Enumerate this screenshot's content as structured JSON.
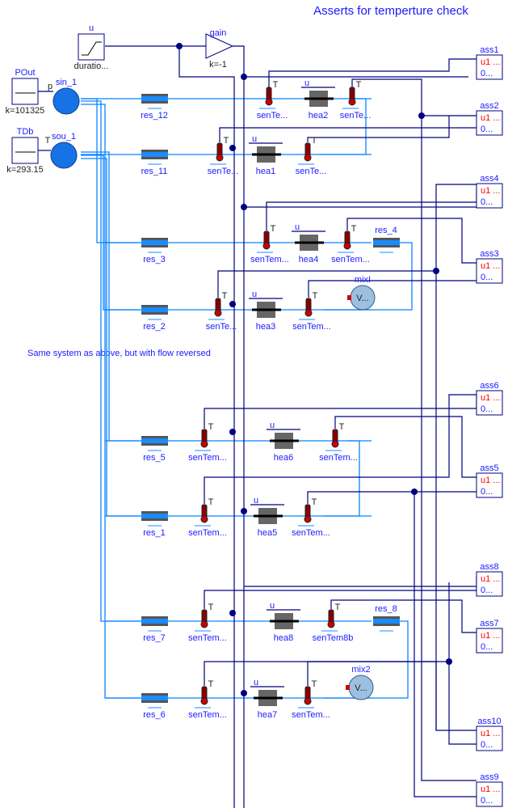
{
  "title": "Asserts for temperture check",
  "note": "Same system as above, but with flow reversed",
  "colors": {
    "fluid": "#0a84ff",
    "signal": "#00007f",
    "label": "#1a1aff",
    "assert_input": "#ff0000"
  },
  "sources": {
    "u": {
      "name": "u",
      "param": "duratio..."
    },
    "gain": {
      "name": "gain",
      "param": "k=-1"
    },
    "POut": {
      "name": "POut",
      "param": "k=101325"
    },
    "TDb": {
      "name": "TDb",
      "param": "k=293.15"
    },
    "sin_1": {
      "name": "sin_1",
      "port": "p"
    },
    "sou_1": {
      "name": "sou_1",
      "port": "T"
    }
  },
  "pipes": {
    "res_12": "res_12",
    "res_11": "res_11",
    "res_3": "res_3",
    "res_2": "res_2",
    "res_5": "res_5",
    "res_1": "res_1",
    "res_7": "res_7",
    "res_6": "res_6",
    "res_4": "res_4",
    "res_8": "res_8"
  },
  "sensors": {
    "s1a": "senTe...",
    "s1b": "senTe...",
    "s2a": "senTe...",
    "s2b": "senTe...",
    "s3a": "senTem...",
    "s3b": "senTem...",
    "s4a": "senTe...",
    "s4b": "senTem...",
    "s5a": "senTem...",
    "s5b": "senTem...",
    "s6a": "senTem...",
    "s6b": "senTem...",
    "s7a": "senTem...",
    "s7b": "senTem8b",
    "s8a": "senTem...",
    "s8b": "senTem...",
    "port_label": "T"
  },
  "heaters": {
    "hea2": "hea2",
    "hea1": "hea1",
    "hea4": "hea4",
    "hea3": "hea3",
    "hea6": "hea6",
    "hea5": "hea5",
    "hea8": "hea8",
    "hea7": "hea7",
    "input_label": "u"
  },
  "volumes": {
    "vol1": {
      "name": "mixI",
      "inner": "V..."
    },
    "vol2": {
      "name": "mix2",
      "inner": "V..."
    }
  },
  "asserts": {
    "ass1": "ass1",
    "ass2": "ass2",
    "ass4": "ass4",
    "ass3": "ass3",
    "ass6": "ass6",
    "ass5": "ass5",
    "ass8": "ass8",
    "ass7": "ass7",
    "ass10": "ass10",
    "ass9": "ass9",
    "in1": "u1 ...",
    "in2": "0..."
  }
}
